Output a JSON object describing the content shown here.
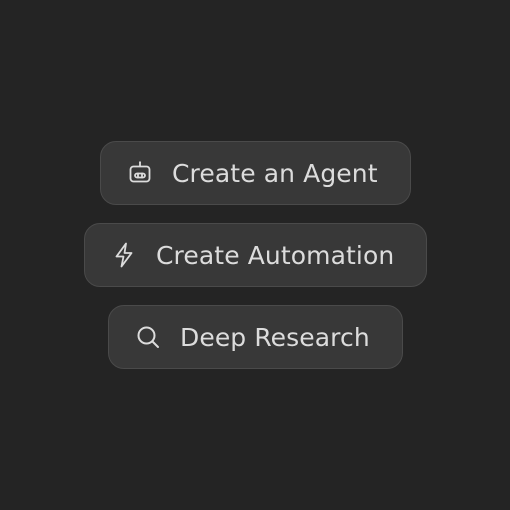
{
  "actions": [
    {
      "label": "Create an Agent",
      "icon": "robot-icon"
    },
    {
      "label": "Create Automation",
      "icon": "lightning-bolt-icon"
    },
    {
      "label": "Deep Research",
      "icon": "search-icon"
    }
  ],
  "colors": {
    "background": "#242424",
    "pill_background": "#383838",
    "pill_border": "#4a4a4a",
    "text": "#dcdcdc"
  }
}
